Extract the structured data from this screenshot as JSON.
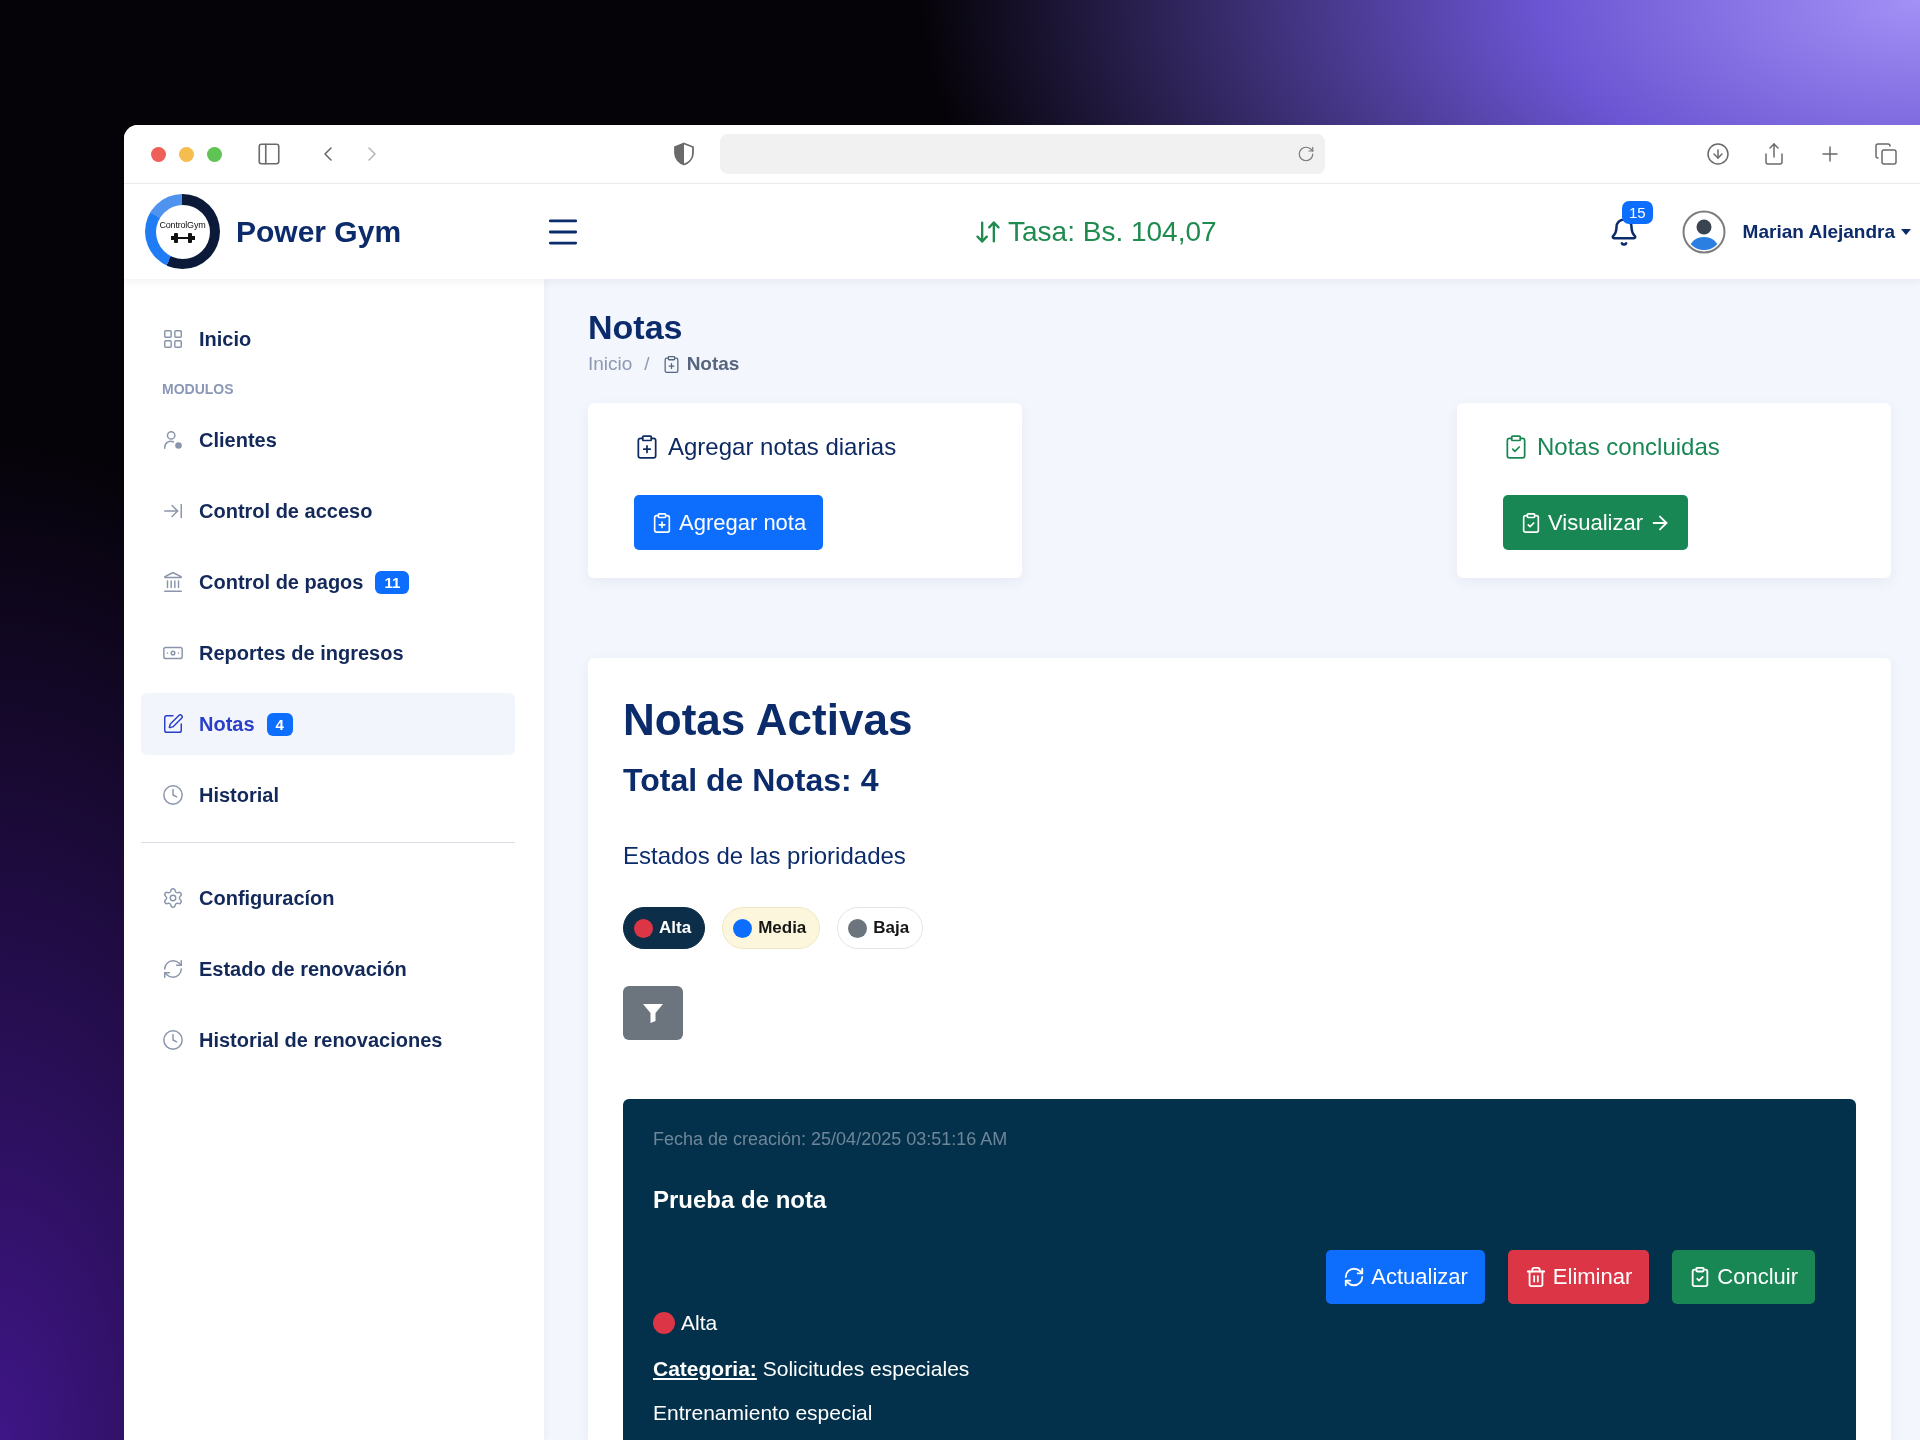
{
  "header": {
    "logo_caption": "ControlGym",
    "brand": "Power Gym",
    "rate": "Tasa: Bs. 104,07",
    "notification_count": "15",
    "user_name": "Marian Alejandra"
  },
  "sidebar": {
    "top_items": [
      {
        "label": "Inicio",
        "selected": false
      }
    ],
    "section_title": "MODULOS",
    "modules": [
      {
        "label": "Clientes",
        "selected": false
      },
      {
        "label": "Control de acceso",
        "selected": false
      },
      {
        "label": "Control de pagos",
        "badge": "11",
        "selected": false
      },
      {
        "label": "Reportes de ingresos",
        "selected": false
      },
      {
        "label": "Notas",
        "badge": "4",
        "selected": true
      },
      {
        "label": "Historial",
        "selected": false
      }
    ],
    "settings": [
      {
        "label": "Configuracíon",
        "selected": false
      },
      {
        "label": "Estado de renovación",
        "selected": false
      },
      {
        "label": "Historial de renovaciones",
        "selected": false
      }
    ]
  },
  "page": {
    "title": "Notas",
    "breadcrumb_separator": "/",
    "breadcrumb": [
      {
        "label": "Inicio",
        "current": false
      },
      {
        "label": "Notas",
        "current": true
      }
    ]
  },
  "cards": [
    {
      "kind": "add",
      "title": "Agregar notas diarias",
      "button": "Agregar nota"
    },
    {
      "kind": "done",
      "title": "Notas concluidas",
      "button": "Visualizar"
    }
  ],
  "active_notes": {
    "title": "Notas Activas",
    "total": "Total de Notas: 4",
    "priorities_title": "Estados de las prioridades",
    "priorities": [
      {
        "label": "Alta",
        "color": "#dc3545",
        "selected": true,
        "highlighted": false
      },
      {
        "label": "Media",
        "color": "#0d6efd",
        "selected": false,
        "highlighted": true
      },
      {
        "label": "Baja",
        "color": "#6c757d",
        "selected": false,
        "highlighted": false
      }
    ],
    "notes": [
      {
        "created": "Fecha de creación: 25/04/2025 03:51:16 AM",
        "title": "Prueba de nota",
        "actions": [
          {
            "kind": "update",
            "label": "Actualizar"
          },
          {
            "kind": "delete",
            "label": "Eliminar"
          },
          {
            "kind": "conclude",
            "label": "Concluir"
          }
        ],
        "priority": {
          "label": "Alta",
          "color": "#dc3545"
        },
        "category": "**Categoria:** Solicitudes especiales",
        "description": "Entrenamiento especial"
      }
    ]
  }
}
